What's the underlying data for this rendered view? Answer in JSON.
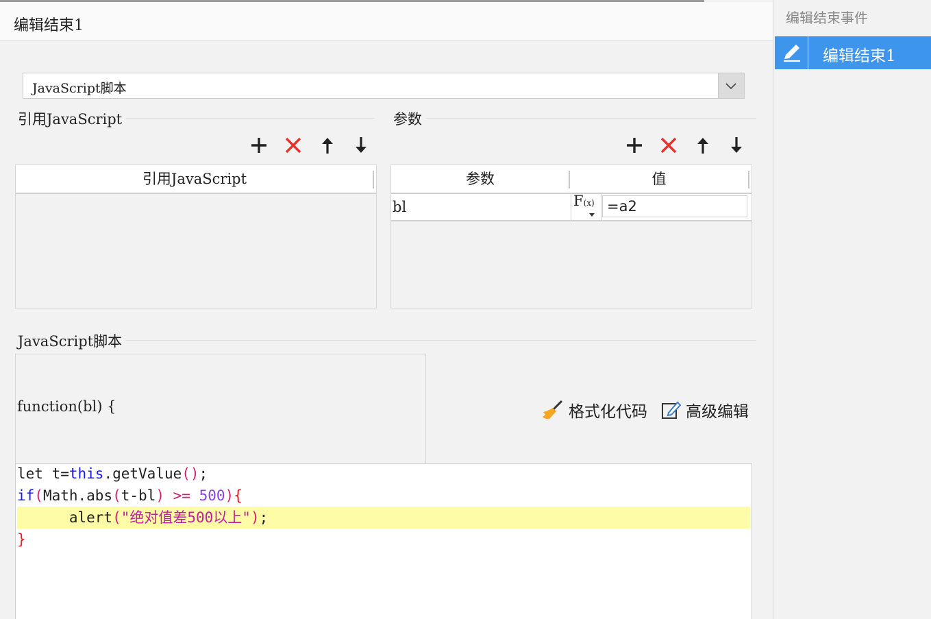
{
  "title": "编辑结束1",
  "script_type": {
    "selected": "JavaScript脚本"
  },
  "ref_js": {
    "section_title": "引用JavaScript",
    "column_header": "引用JavaScript",
    "toolbar": [
      "add-icon",
      "delete-icon",
      "up-arrow-icon",
      "down-arrow-icon"
    ]
  },
  "params": {
    "section_title": "参数",
    "columns": [
      "参数",
      "值"
    ],
    "rows": [
      {
        "name": "bl",
        "fx": "F",
        "fx_sub": "(x)",
        "value": "=a2"
      }
    ],
    "toolbar": [
      "add-icon",
      "delete-icon",
      "up-arrow-icon",
      "down-arrow-icon"
    ]
  },
  "script": {
    "section_title": "JavaScript脚本",
    "function_header": "function(bl) {",
    "format_label": "格式化代码",
    "advanced_label": "高级编辑",
    "code_lines": [
      "let t=this.getValue();",
      "if(Math.abs(t-bl) >= 500){",
      "    alert(\"绝对值差500以上\");",
      "}"
    ]
  },
  "side_panel": {
    "header": "编辑结束事件",
    "items": [
      {
        "label": "编辑结束1",
        "icon": "pencil-icon",
        "selected": true
      }
    ]
  },
  "colors": {
    "accent": "#3d95ec",
    "delete": "#e8312a",
    "highlight": "#fffca8",
    "keyword": "#1a1aff"
  }
}
